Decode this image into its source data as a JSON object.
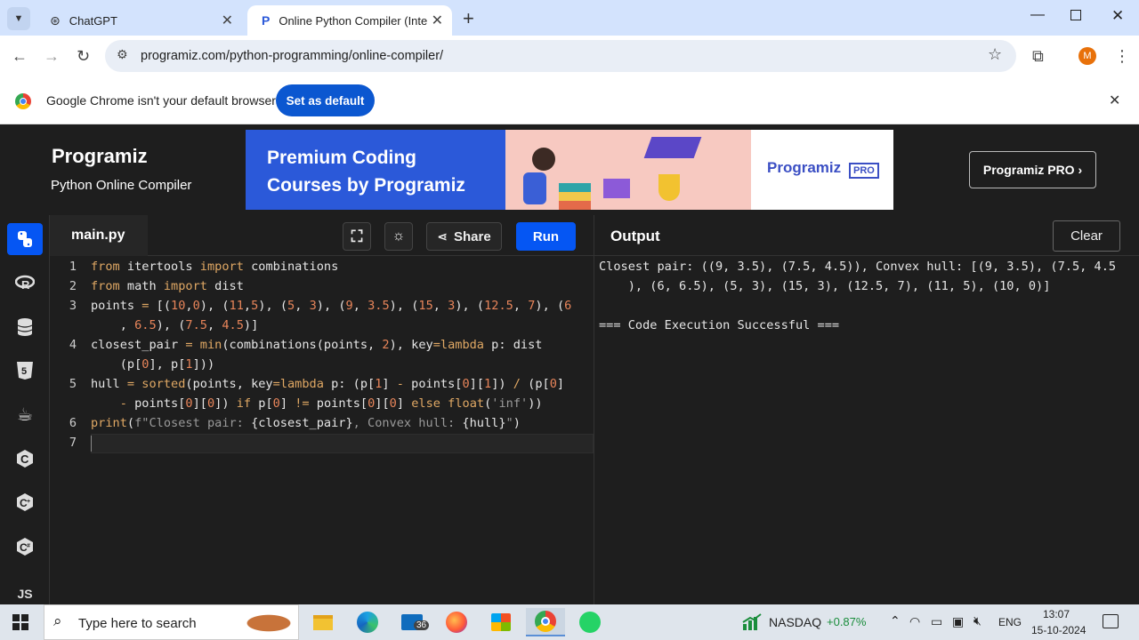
{
  "browser": {
    "tabs": [
      {
        "title": "ChatGPT"
      },
      {
        "title": "Online Python Compiler (Interp"
      }
    ],
    "url": "programiz.com/python-programming/online-compiler/",
    "profile_initial": "M",
    "infobar": {
      "message": "Google Chrome isn't your default browser",
      "button": "Set as default"
    }
  },
  "site": {
    "logo": "Programiz",
    "subtitle": "Python Online Compiler",
    "banner": {
      "line1": "Premium Coding",
      "line2": "Courses by Programiz",
      "brand": "Programiz",
      "badge": "PRO"
    },
    "pro_button": "Programiz PRO ›",
    "sidebar_icons": [
      "python-icon",
      "r-icon",
      "sql-icon",
      "html-icon",
      "java-icon",
      "c-icon",
      "cpp-icon",
      "csharp-icon",
      "js-icon"
    ],
    "sidebar_js_label": "JS"
  },
  "editor": {
    "filename": "main.py",
    "share_label": "Share",
    "run_label": "Run",
    "line_numbers": [
      "1",
      "2",
      "3",
      "4",
      "5",
      "6",
      "7"
    ]
  },
  "output": {
    "title": "Output",
    "clear_label": "Clear",
    "lines": [
      "Closest pair: ((9, 3.5), (7.5, 4.5)), Convex hull: [(9, 3.5), (7.5, 4.5",
      "    ), (6, 6.5), (5, 3), (15, 3), (12.5, 7), (11, 5), (10, 0)]",
      "",
      "=== Code Execution Successful ==="
    ]
  },
  "taskbar": {
    "search_placeholder": "Type here to search",
    "mail_badge": "36",
    "ticker": "NASDAQ",
    "ticker_change": "+0.87%",
    "language": "ENG",
    "time": "13:07",
    "date": "15-10-2024"
  }
}
